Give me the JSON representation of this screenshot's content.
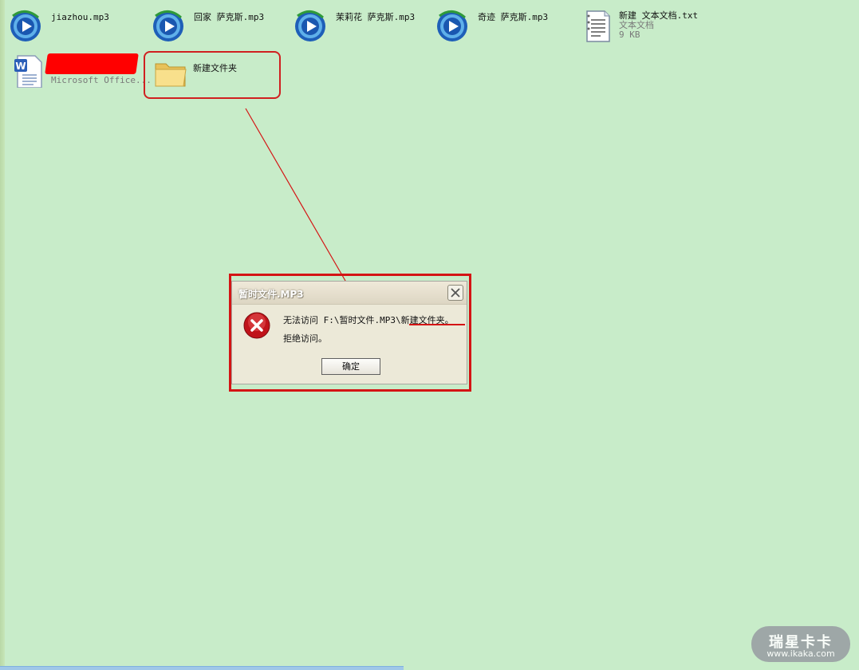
{
  "desktop": {
    "row1": [
      {
        "label": "jiazhou.mp3"
      },
      {
        "label": "回家 萨克斯.mp3"
      },
      {
        "label": "茉莉花 萨克斯.mp3"
      },
      {
        "label": "奇迹 萨克斯.mp3"
      }
    ],
    "text_file": {
      "label": "新建 文本文档.txt",
      "type": "文本文档",
      "size": "9 KB"
    },
    "word_doc": {
      "sub": "Microsoft Office..."
    },
    "folder": {
      "label": "新建文件夹"
    }
  },
  "dialog": {
    "title": "暂时文件.MP3",
    "message_line1": "无法访问 F:\\暂时文件.MP3\\新建文件夹。",
    "message_line2": "拒绝访问。",
    "ok_label": "确定"
  },
  "watermark": {
    "line1": "瑞星卡卡",
    "line2": "www.ikaka.com"
  },
  "colors": {
    "background": "#c8ecc9",
    "annotation_red": "#d41414"
  },
  "icons": {
    "media": "media-player-icon",
    "text": "text-document-icon",
    "word": "word-document-icon",
    "folder": "folder-icon",
    "error": "error-icon",
    "close": "close-icon"
  }
}
